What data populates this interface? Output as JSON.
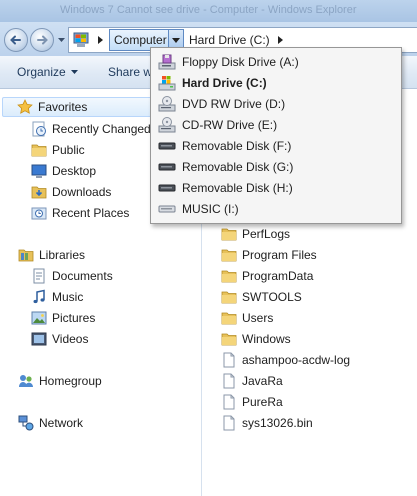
{
  "window": {
    "title": "Windows 7 Cannot see drive - Computer - Windows Explorer"
  },
  "address_bar": {
    "crumbs": [
      {
        "label": "Computer",
        "icon": "computer-icon"
      },
      {
        "label": "Hard Drive (C:)",
        "icon": "chevron-right-icon"
      }
    ]
  },
  "toolbar": {
    "organize_label": "Organize",
    "share_label": "Share w"
  },
  "drive_menu": {
    "items": [
      {
        "label": "Floppy Disk Drive (A:)",
        "icon": "floppy-drive-icon"
      },
      {
        "label": "Hard Drive (C:)",
        "icon": "hard-drive-windows-icon",
        "current": true
      },
      {
        "label": "DVD RW Drive (D:)",
        "icon": "dvd-drive-icon"
      },
      {
        "label": "CD-RW Drive (E:)",
        "icon": "cd-drive-icon"
      },
      {
        "label": "Removable Disk (F:)",
        "icon": "removable-disk-icon"
      },
      {
        "label": "Removable Disk (G:)",
        "icon": "removable-disk-icon"
      },
      {
        "label": "Removable Disk (H:)",
        "icon": "removable-disk-icon"
      },
      {
        "label": "MUSIC (I:)",
        "icon": "music-drive-icon"
      }
    ]
  },
  "nav_pane": {
    "favorites": {
      "label": "Favorites",
      "items": [
        "Recently Changed",
        "Public",
        "Desktop",
        "Downloads",
        "Recent Places"
      ]
    },
    "libraries": {
      "label": "Libraries",
      "items": [
        "Documents",
        "Music",
        "Pictures",
        "Videos"
      ]
    },
    "homegroup_label": "Homegroup",
    "network_label": "Network"
  },
  "files": [
    {
      "name": "PerfLogs",
      "type": "folder"
    },
    {
      "name": "Program Files",
      "type": "folder"
    },
    {
      "name": "ProgramData",
      "type": "folder"
    },
    {
      "name": "SWTOOLS",
      "type": "folder"
    },
    {
      "name": "Users",
      "type": "folder"
    },
    {
      "name": "Windows",
      "type": "folder"
    },
    {
      "name": "ashampoo-acdw-log",
      "type": "file"
    },
    {
      "name": "JavaRa",
      "type": "file"
    },
    {
      "name": "PureRa",
      "type": "file"
    },
    {
      "name": "sys13026.bin",
      "type": "file"
    }
  ],
  "colors": {
    "accent": "#5f8ac3",
    "folder": "#f2cf6c",
    "selection": "#dbecfc"
  }
}
